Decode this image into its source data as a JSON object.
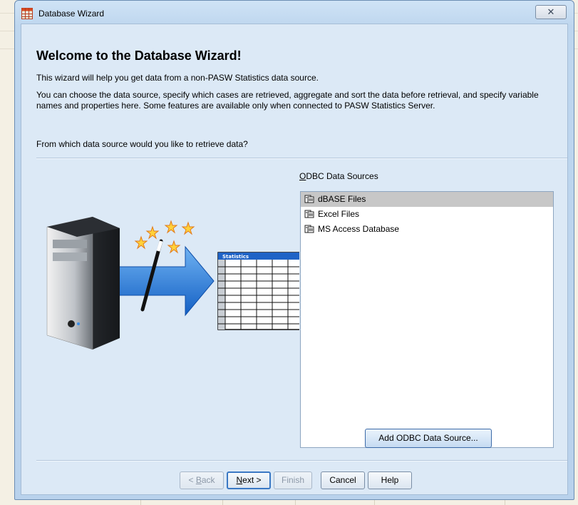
{
  "window": {
    "title": "Database Wizard",
    "close_glyph": "✕"
  },
  "wizard": {
    "heading": "Welcome to the Database Wizard!",
    "intro": "This wizard will help you get data from a non-PASW Statistics data source.",
    "description": "You can choose the data source, specify which cases are retrieved, aggregate and sort the data before retrieval, and specify variable names and properties here. Some features are available only when connected to PASW Statistics Server.",
    "question": "From which data source would you like to retrieve data?"
  },
  "illustration": {
    "table_header": "Statistics"
  },
  "odbc": {
    "label_prefix": "",
    "label_mnemonic": "O",
    "label_rest": "DBC Data Sources",
    "items": [
      {
        "label": "dBASE Files",
        "icon": "database-icon"
      },
      {
        "label": "Excel Files",
        "icon": "database-icon"
      },
      {
        "label": "MS Access Database",
        "icon": "database-icon"
      }
    ],
    "selected_index": 0,
    "add_button": "Add ODBC Data Source..."
  },
  "buttons": {
    "back_prefix": "< ",
    "back_mnemonic": "B",
    "back_rest": "ack",
    "next_mnemonic": "N",
    "next_rest": "ext >",
    "finish": "Finish",
    "cancel": "Cancel",
    "help": "Help"
  },
  "colors": {
    "window_bg": "#dce9f6",
    "selection": "#c7c7c7",
    "default_button_border": "#3a78c4",
    "arrow_blue": "#1e74d8"
  }
}
